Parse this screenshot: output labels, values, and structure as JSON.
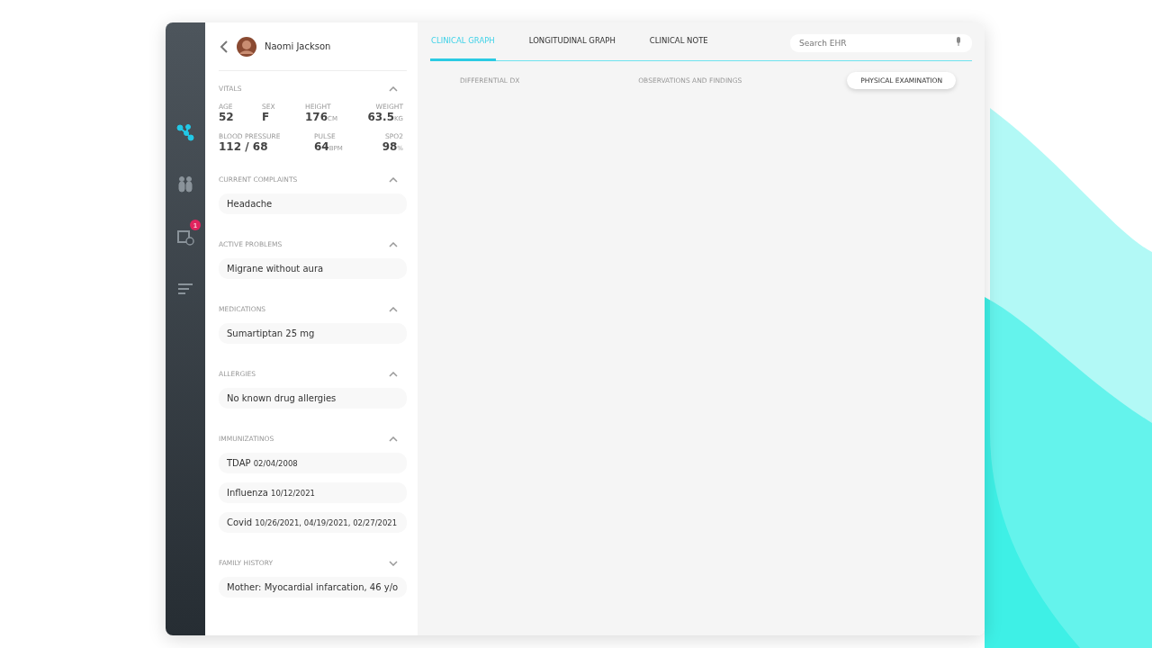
{
  "rail": [
    {
      "kind": "graph",
      "selected": true
    },
    {
      "kind": "people",
      "selected": false
    },
    {
      "kind": "calendar",
      "selected": false,
      "badge": "1"
    },
    {
      "kind": "filters",
      "selected": false
    }
  ],
  "patient": {
    "name": "Naomi Jackson"
  },
  "vitals": {
    "title": "VITALS",
    "expanded": true,
    "readings": [
      {
        "label": "AGE",
        "value": "52"
      },
      {
        "label": "SEX",
        "value": "F"
      },
      {
        "label": "HEIGHT",
        "value": "176",
        "unit": "CM"
      },
      {
        "label": "WEIGHT",
        "value": "63.5",
        "unit": "KG"
      },
      {
        "label": "BLOOD PRESSURE",
        "value": "112 / 68"
      },
      {
        "label": "PULSE",
        "value": "64",
        "unit": "BPM"
      },
      {
        "label": "SPO2",
        "value": "98",
        "unit": "%"
      }
    ]
  },
  "sections": [
    {
      "title": "CURRENT COMPLAINTS",
      "expanded": true,
      "items": [
        {
          "name": "Headache"
        }
      ]
    },
    {
      "title": "ACTIVE PROBLEMS",
      "expanded": true,
      "items": [
        {
          "name": "Migrane without aura"
        }
      ]
    },
    {
      "title": "MEDICATIONS",
      "expanded": true,
      "items": [
        {
          "name": "Sumartiptan 25 mg"
        }
      ]
    },
    {
      "title": "ALLERGIES",
      "expanded": true,
      "items": [
        {
          "name": "No known drug allergies"
        }
      ]
    },
    {
      "title": "IMMUNIZATINOS",
      "expanded": true,
      "items": [
        {
          "name": "TDAP",
          "detail": "02/04/2008"
        },
        {
          "name": "Influenza",
          "detail": "10/12/2021"
        },
        {
          "name": "Covid",
          "detail": "10/26/2021, 04/19/2021, 02/27/2021"
        }
      ]
    },
    {
      "title": "FAMILY  HISTORY",
      "expanded": false,
      "items": [
        {
          "name": "Mother: Myocardial infarcation, 46 y/o"
        }
      ]
    }
  ],
  "tabs": [
    {
      "label": "CLINICAL GRAPH",
      "selected": true
    },
    {
      "label": "LONGITUDINAL GRAPH",
      "selected": false
    },
    {
      "label": "CLINICAL NOTE",
      "selected": false
    }
  ],
  "search": {
    "placeholder": "Search EHR"
  },
  "subtabs": [
    {
      "label": "DIFFERENTIAL DX",
      "selected": false
    },
    {
      "label": "OBSERVATIONS AND FINDINGS",
      "selected": false
    },
    {
      "label": "PHYSICAL EXAMINATION",
      "selected": true
    }
  ]
}
